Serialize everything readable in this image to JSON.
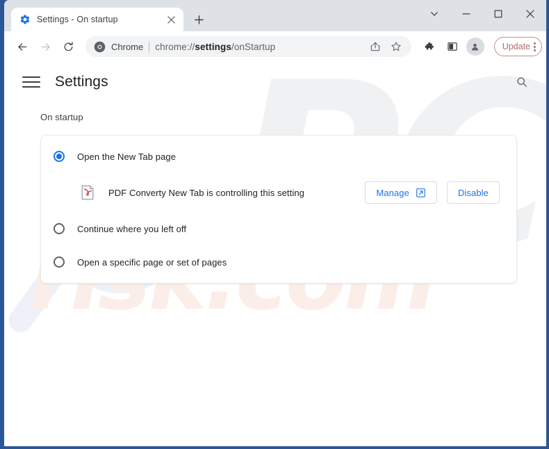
{
  "window": {
    "controls": {
      "tab_search_label": "tab-search",
      "minimize_label": "minimize",
      "maximize_label": "maximize",
      "close_label": "close"
    }
  },
  "tab_strip": {
    "tabs": [
      {
        "title": "Settings - On startup",
        "favicon": "gear-icon",
        "close_label": "close-tab"
      }
    ],
    "new_tab_label": "new-tab"
  },
  "toolbar": {
    "back_label": "back",
    "forward_label": "forward",
    "reload_label": "reload",
    "omnibox": {
      "chip_icon": "chrome-logo-icon",
      "chip_label": "Chrome",
      "url_prefix": "chrome://",
      "url_bold": "settings",
      "url_suffix": "/onStartup",
      "share_label": "share",
      "bookmark_label": "bookmark-star"
    },
    "extensions_label": "extensions",
    "side_panel_label": "side-panel",
    "profile_label": "profile",
    "update_label": "Update",
    "menu_label": "chrome-menu"
  },
  "settings": {
    "menu_label": "main-menu",
    "title": "Settings",
    "search_label": "search-settings"
  },
  "on_startup": {
    "section_label": "On startup",
    "options": [
      {
        "label": "Open the New Tab page",
        "checked": true
      },
      {
        "label": "Continue where you left off",
        "checked": false
      },
      {
        "label": "Open a specific page or set of pages",
        "checked": false
      }
    ],
    "extension_notice": {
      "icon": "pdf-file-icon",
      "text": "PDF Converty New Tab is controlling this setting",
      "manage_label": "Manage",
      "manage_icon": "external-link-icon",
      "disable_label": "Disable"
    }
  },
  "watermark": {
    "mark_top": "PC",
    "mark_bottom": "risk.com"
  },
  "colors": {
    "accent_blue": "#1a73e8",
    "frame_blue": "#2b5797",
    "tabstrip_gray": "#dee1e6",
    "update_red": "#b46a6a",
    "pdf_red": "#cc5555"
  }
}
